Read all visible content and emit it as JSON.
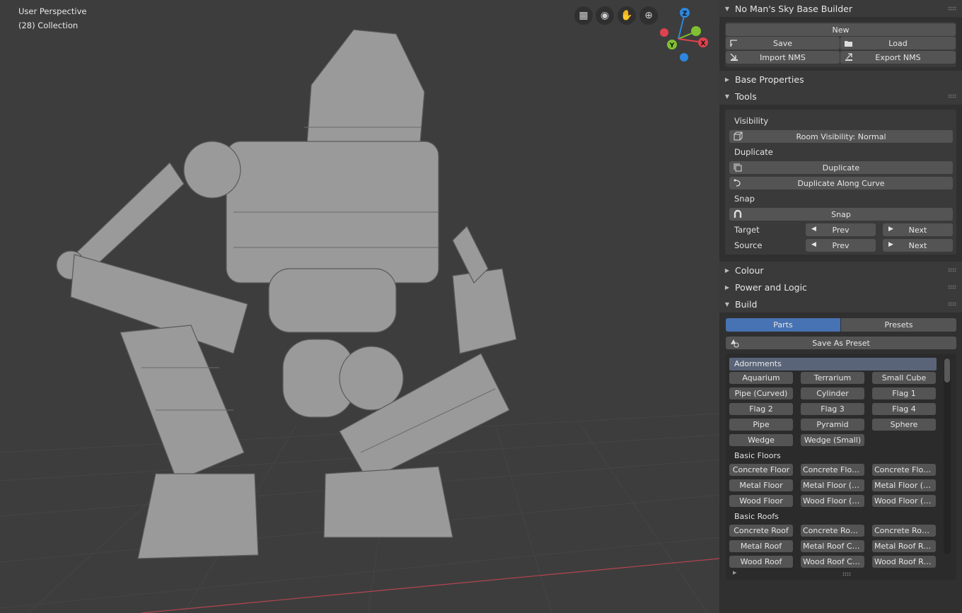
{
  "viewport": {
    "perspective_label": "User Perspective",
    "collection_label": "(28) Collection",
    "gizmo_axes": [
      "Z",
      "Y",
      "X"
    ],
    "colors": {
      "x": "#e0414e",
      "y": "#80c032",
      "z": "#2e86de",
      "grid_x": "#b4454f"
    }
  },
  "addon": {
    "title": "No Man's Sky Base Builder",
    "new_label": "New",
    "save_label": "Save",
    "load_label": "Load",
    "import_label": "Import NMS",
    "export_label": "Export NMS"
  },
  "base_properties": {
    "title": "Base Properties"
  },
  "tools": {
    "title": "Tools",
    "visibility_label": "Visibility",
    "room_visibility_label": "Room Visibility: Normal",
    "duplicate_section": "Duplicate",
    "duplicate_label": "Duplicate",
    "duplicate_curve_label": "Duplicate Along Curve",
    "snap_section": "Snap",
    "snap_label": "Snap",
    "target_label": "Target",
    "source_label": "Source",
    "prev_label": "Prev",
    "next_label": "Next"
  },
  "colour": {
    "title": "Colour"
  },
  "power": {
    "title": "Power and Logic"
  },
  "build": {
    "title": "Build",
    "tab_parts": "Parts",
    "tab_presets": "Presets",
    "save_preset_label": "Save As Preset",
    "accent_color": "#4772b3",
    "groups": [
      {
        "name": "Adornments",
        "items": [
          "Aquarium",
          "Terrarium",
          "Small Cube",
          "Pipe (Curved)",
          "Cylinder",
          "Flag 1",
          "Flag 2",
          "Flag 3",
          "Flag 4",
          "Pipe",
          "Pyramid",
          "Sphere",
          "Wedge",
          "Wedge (Small)"
        ]
      },
      {
        "name": "Basic Floors",
        "items": [
          "Concrete Floor",
          "Concrete Floor (..",
          "Concrete  Floor ..",
          "Metal Floor",
          "Metal Floor (Sm..",
          "Metal Floor (Gla..",
          "Wood Floor",
          "Wood Floor (Sm..",
          "Wood Floor (Gla.."
        ]
      },
      {
        "name": "Basic Roofs",
        "items": [
          "Concrete Roof",
          "Concrete Roof C..",
          "Concrete Roof R..",
          "Metal Roof",
          "Metal Roof Corner",
          "Metal Roof Ramp",
          "Wood Roof",
          "Wood Roof Corner",
          "Wood Roof Ramp"
        ]
      }
    ]
  }
}
